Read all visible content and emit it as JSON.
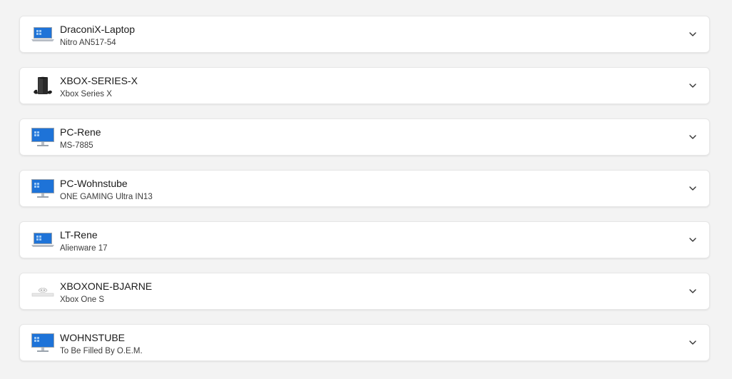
{
  "devices": [
    {
      "name": "DraconiX-Laptop",
      "model": "Nitro AN517-54",
      "icon": "laptop-icon"
    },
    {
      "name": "XBOX-SERIES-X",
      "model": "Xbox Series X",
      "icon": "xbox-series-x-icon"
    },
    {
      "name": "PC-Rene",
      "model": "MS-7885",
      "icon": "desktop-monitor-icon"
    },
    {
      "name": "PC-Wohnstube",
      "model": "ONE GAMING Ultra IN13",
      "icon": "desktop-monitor-icon"
    },
    {
      "name": "LT-Rene",
      "model": "Alienware 17",
      "icon": "laptop-icon"
    },
    {
      "name": "XBOXONE-BJARNE",
      "model": "Xbox One S",
      "icon": "xbox-one-s-icon"
    },
    {
      "name": "WOHNSTUBE",
      "model": "To Be Filled By O.E.M.",
      "icon": "desktop-monitor-icon"
    }
  ],
  "colors": {
    "screen_blue": "#1e73d8",
    "background": "#f3f3f3",
    "card": "#ffffff"
  }
}
